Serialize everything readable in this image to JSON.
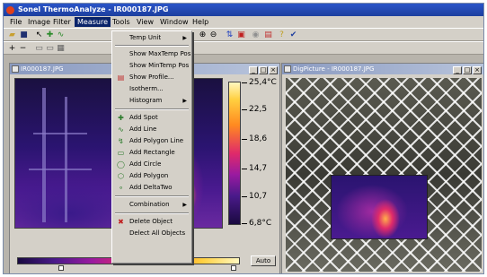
{
  "app": {
    "title": "Sonel ThermoAnalyze - IR000187.JPG"
  },
  "menubar": {
    "items": [
      {
        "label": "File"
      },
      {
        "label": "Image"
      },
      {
        "label": "Filter"
      },
      {
        "label": "Measure"
      },
      {
        "label": "Tools"
      },
      {
        "label": "View"
      },
      {
        "label": "Window"
      },
      {
        "label": "Help"
      }
    ]
  },
  "measure_menu": {
    "items": [
      {
        "label": "Temp Unit",
        "submenu": true,
        "icon": ""
      },
      {
        "label": "Show MaxTemp Pos",
        "icon": ""
      },
      {
        "label": "Show MinTemp Pos",
        "icon": ""
      },
      {
        "label": "Show Profile...",
        "icon": "profile-icon"
      },
      {
        "label": "Isotherm...",
        "icon": ""
      },
      {
        "label": "Histogram",
        "submenu": true,
        "icon": ""
      },
      {
        "label": "Add Spot",
        "icon": "spot-icon"
      },
      {
        "label": "Add Line",
        "icon": "line-icon"
      },
      {
        "label": "Add Polygon Line",
        "icon": "polyline-icon"
      },
      {
        "label": "Add Rectangle",
        "icon": "rectangle-icon"
      },
      {
        "label": "Add Circle",
        "icon": "circle-icon"
      },
      {
        "label": "Add Polygon",
        "icon": "polygon-icon"
      },
      {
        "label": "Add DeltaTwo",
        "icon": "delta-icon"
      },
      {
        "label": "Combination",
        "submenu": true,
        "icon": ""
      },
      {
        "label": "Delete Object",
        "icon": "delete-icon"
      },
      {
        "label": "Delect All Objects",
        "icon": ""
      }
    ]
  },
  "thermal_window": {
    "title": "IR000187.JPG",
    "scale_labels": [
      "25,4°C",
      "22,5",
      "18,6",
      "14,7",
      "10,7",
      "6,8°C"
    ],
    "auto_label": "Auto"
  },
  "photo_window": {
    "title": "DigPicture - IR000187.JPG"
  },
  "colors": {
    "menu_highlight": "#0a246a",
    "title_bar": "#2a55c8",
    "window_face": "#d4d0c8"
  }
}
